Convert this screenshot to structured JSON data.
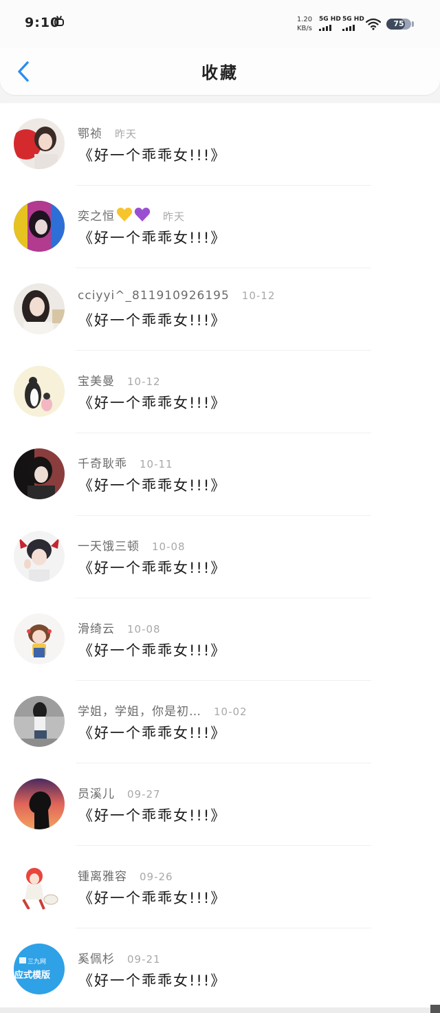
{
  "status_bar": {
    "time": "9:10",
    "net_speed_value": "1.20",
    "net_speed_unit": "KB/s",
    "signal_1_label": "5G HD",
    "signal_2_label": "5G HD",
    "battery_level": "75",
    "icons": [
      "tv-icon",
      "signal-icon",
      "wifi-icon",
      "battery-icon"
    ]
  },
  "header": {
    "title": "收藏",
    "back_icon": "chevron-left-icon"
  },
  "colors": {
    "accent": "#2b8df0",
    "text_primary": "#1a1a1a",
    "text_secondary": "#6b6b6b",
    "text_date": "#a8a8a8"
  },
  "items": [
    {
      "name": "鄂祯",
      "date": "昨天",
      "message": "《好一个乖乖女!!!》",
      "hearts": []
    },
    {
      "name": "奕之恒",
      "date": "昨天",
      "message": "《好一个乖乖女!!!》",
      "hearts": [
        "yellow-heart",
        "purple-heart"
      ]
    },
    {
      "name": "cciyyi^_811910926195",
      "date": "10-12",
      "message": "《好一个乖乖女!!!》",
      "hearts": []
    },
    {
      "name": "宝美曼",
      "date": "10-12",
      "message": "《好一个乖乖女!!!》",
      "hearts": []
    },
    {
      "name": "千奇耿乖",
      "date": "10-11",
      "message": "《好一个乖乖女!!!》",
      "hearts": []
    },
    {
      "name": "一天饿三顿",
      "date": "10-08",
      "message": "《好一个乖乖女!!!》",
      "hearts": []
    },
    {
      "name": "滑绮云",
      "date": "10-08",
      "message": "《好一个乖乖女!!!》",
      "hearts": []
    },
    {
      "name": "学姐，学姐，你是初…",
      "date": "10-02",
      "message": "《好一个乖乖女!!!》",
      "hearts": []
    },
    {
      "name": "员溪儿",
      "date": "09-27",
      "message": "《好一个乖乖女!!!》",
      "hearts": []
    },
    {
      "name": "锺离雅容",
      "date": "09-26",
      "message": "《好一个乖乖女!!!》",
      "hearts": []
    },
    {
      "name": "奚佩杉",
      "date": "09-21",
      "message": "《好一个乖乖女!!!》",
      "hearts": [],
      "avatar_text_1": "三九网",
      "avatar_text_2": "应式模版"
    }
  ]
}
